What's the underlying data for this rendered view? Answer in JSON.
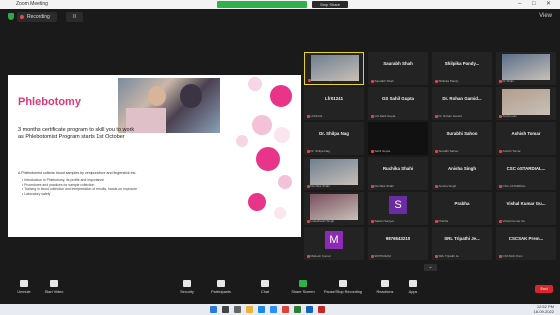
{
  "titlebar": {
    "app_title": "Zoom Meeting",
    "stop_share": "Stop Share"
  },
  "topbar": {
    "recording": "Recording",
    "pause": "II",
    "view": "View"
  },
  "slide": {
    "title": "Phlebotomy",
    "subtitle": "3 months certificate program to skill you to work as Phlebotomist Program starts 1st October",
    "intro": "A Phlebotomist collects blood samples by venipuncture and fingerstick etc.",
    "bullets": [
      "Introduction to Phlebotomy, its profile and importance",
      "Procedures and practices for sample collection",
      "Training in blood collection and interpretation of results, hands-on exposure",
      "Laboratory safety"
    ]
  },
  "gallery": {
    "tiles": [
      {
        "name": "",
        "caption": "Dr. Ashish Singh",
        "type": "video",
        "active": true
      },
      {
        "name": "Saurabh Shah",
        "caption": "Saurabh Shah",
        "type": "name"
      },
      {
        "name": "Shilpika Pandy...",
        "caption": "Shilpika Pandy",
        "type": "name"
      },
      {
        "name": "",
        "caption": "Dr Shilpi",
        "type": "video"
      },
      {
        "name": "Lfr01241",
        "caption": "Lfr01241",
        "type": "name"
      },
      {
        "name": "GS Sahil Gupta",
        "caption": "GS Sahil Gupta",
        "type": "name"
      },
      {
        "name": "Dr. Rohan Gamid...",
        "caption": "Dr. Rohan Gamid",
        "type": "name"
      },
      {
        "name": "",
        "caption": "Anshuman",
        "type": "video"
      },
      {
        "name": "Dr. Shilpa Nag",
        "caption": "Dr. Shilpa Nag",
        "type": "name"
      },
      {
        "name": "",
        "caption": "Sahil Gupta",
        "type": "dark"
      },
      {
        "name": "Surabhi Sahoo",
        "caption": "Surabhi Sahoo",
        "type": "name"
      },
      {
        "name": "Ashish Tomar",
        "caption": "Ashish Tomar",
        "type": "name"
      },
      {
        "name": "",
        "caption": "Ruchika Shahi",
        "type": "video"
      },
      {
        "name": "Ruchika Shahi",
        "caption": "Ruchika Shahi",
        "type": "name"
      },
      {
        "name": "Anisha Singh",
        "caption": "Anisha Singh",
        "type": "name"
      },
      {
        "name": "CSC oSTARDIAL...",
        "caption": "CSC oSTARDIAL",
        "type": "name"
      },
      {
        "name": "",
        "caption": "Lokeshwari Singh",
        "type": "video"
      },
      {
        "name": "S",
        "caption": "Sakshi Sanyal",
        "type": "avatar",
        "color": "#6a2ca3"
      },
      {
        "name": "Prabha",
        "caption": "Prabha",
        "type": "name"
      },
      {
        "name": "Vishal Kumar Gu...",
        "caption": "Vishal Kumar Gu",
        "type": "name"
      },
      {
        "name": "M",
        "caption": "Mahesh Kumar",
        "type": "avatar",
        "color": "#8b2ab4"
      },
      {
        "name": "9876543210",
        "caption": "9876543210",
        "type": "name"
      },
      {
        "name": "SRL Tripathi Je...",
        "caption": "SRL Tripathi Je",
        "type": "name"
      },
      {
        "name": "CSCSAK Prem...",
        "caption": "CSCSAK Prem",
        "type": "name"
      }
    ]
  },
  "toolbar": {
    "items": [
      {
        "label": "Unmute",
        "icon": "mic-icon"
      },
      {
        "label": "Start Video",
        "icon": "video-icon"
      },
      {
        "label": "Security",
        "icon": "shield-icon"
      },
      {
        "label": "Participants",
        "icon": "participants-icon"
      },
      {
        "label": "Chat",
        "icon": "chat-icon"
      },
      {
        "label": "Share Screen",
        "icon": "share-screen-icon"
      },
      {
        "label": "Pause/Stop Recording",
        "icon": "record-icon"
      },
      {
        "label": "Reactions",
        "icon": "reactions-icon"
      },
      {
        "label": "Apps",
        "icon": "apps-icon"
      }
    ],
    "end": "End"
  },
  "taskbar": {
    "time": "12:52 PM",
    "date": "18-09-2022"
  }
}
